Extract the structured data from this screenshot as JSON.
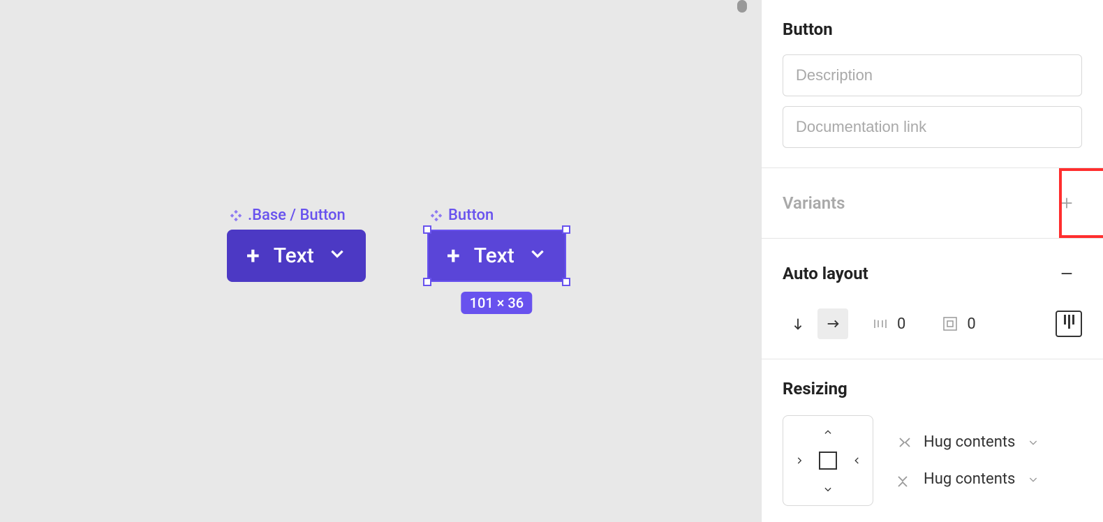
{
  "canvas": {
    "componentA": {
      "label": ".Base / Button",
      "text": "Text"
    },
    "componentB": {
      "label": "Button",
      "text": "Text",
      "sizeBadge": "101 × 36"
    }
  },
  "sidebar": {
    "header": {
      "title": "Button",
      "descriptionPlaceholder": "Description",
      "docPlaceholder": "Documentation link"
    },
    "variants": {
      "title": "Variants"
    },
    "autoLayout": {
      "title": "Auto layout",
      "gapValue": "0",
      "paddingValue": "0"
    },
    "resizing": {
      "title": "Resizing",
      "horizontal": "Hug contents",
      "vertical": "Hug contents"
    }
  }
}
